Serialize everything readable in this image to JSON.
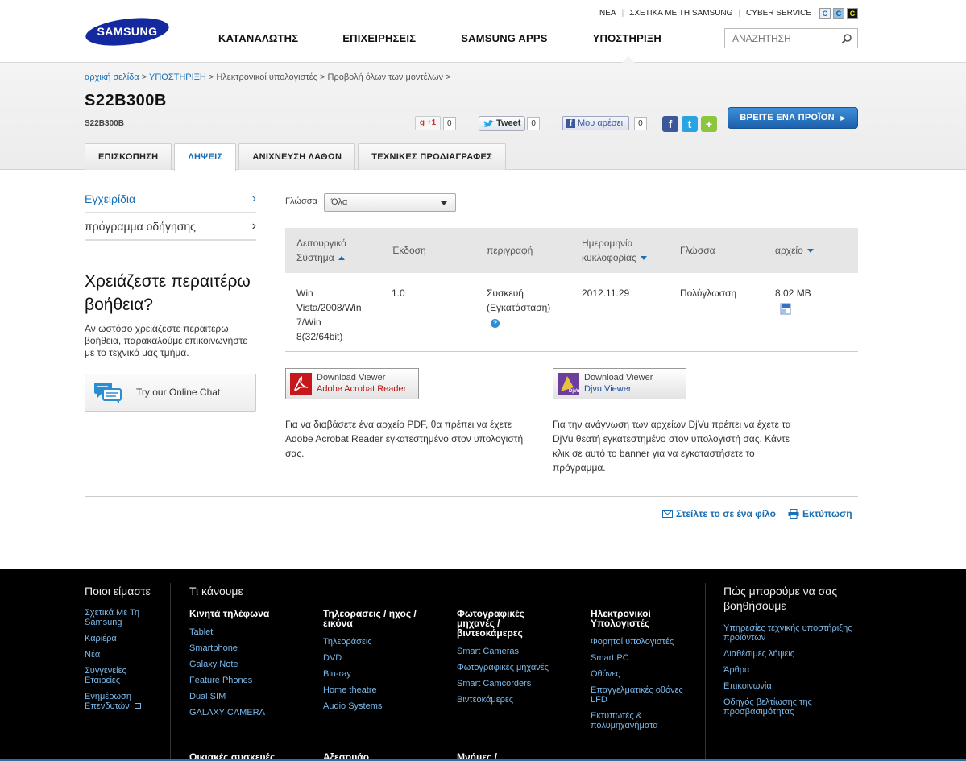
{
  "header": {
    "logo_text": "SAMSUNG",
    "util_links": [
      "ΝΕΑ",
      "ΣΧΕΤΙΚΑ ΜΕ ΤΗ SAMSUNG",
      "CYBER SERVICE"
    ],
    "contrast_buttons": [
      "C",
      "C",
      "C"
    ],
    "nav": [
      "ΚΑΤΑΝΑΛΩΤΗΣ",
      "ΕΠΙΧΕΙΡΗΣΕΙΣ",
      "SAMSUNG APPS",
      "ΥΠΟΣΤΗΡΙΞΗ"
    ],
    "search_placeholder": "ΑΝΑΖΗΤΗΣΗ"
  },
  "product": {
    "breadcrumb": [
      "αρχική σελίδα",
      "ΥΠΟΣΤΗΡΙΞΗ",
      "Ηλεκτρονικοί υπολογιστές",
      "Προβολή όλων των μοντέλων"
    ],
    "breadcrumb_sep": ">",
    "title": "S22B300B",
    "subtitle": "S22B300B",
    "social": {
      "gplus_label": "+1",
      "gplus_count": "0",
      "tweet_label": "Tweet",
      "tweet_count": "0",
      "like_label": "Μου αρέσει!",
      "like_count": "0"
    },
    "find_button": "ΒΡΕΙΤΕ ΕΝΑ ΠΡΟΪΟΝ",
    "tabs": [
      "ΕΠΙΣΚΟΠΗΣΗ",
      "ΛΗΨΕΙΣ",
      "ΑΝΙΧΝΕΥΣΗ ΛΑΘΩΝ",
      "ΤΕΧΝΙΚΕΣ ΠΡΟΔΙΑΓΡΑΦΕΣ"
    ],
    "active_tab": "ΛΗΨΕΙΣ"
  },
  "sidebar": {
    "items": [
      "Εγχειρίδια",
      "πρόγραμμα οδήγησης"
    ],
    "help_title": "Χρειάζεστε περαιτέρω βοήθεια?",
    "help_text": "Αν ωστόσο χρειάζεστε περαιτερω βοήθεια, παρακαλούμε επικοινωνήστε με το τεχνικό μας τμήμα.",
    "chat_label": "Try our Online Chat"
  },
  "downloads": {
    "language_label": "Γλώσσα",
    "language_value": "Όλα",
    "columns": {
      "os_line1": "Λειτουργικό",
      "os_line2": "Σύστημα",
      "version": "Έκδοση",
      "description": "περιγραφή",
      "date_line1": "Ημερομηνία",
      "date_line2": "κυκλοφορίας",
      "language": "Γλώσσα",
      "file": "αρχείο"
    },
    "rows": [
      {
        "os_lines": [
          "Win",
          "Vista/2008/Win",
          "7/Win",
          "8(32/64bit)"
        ],
        "version": "1.0",
        "description_line1": "Συσκευή",
        "description_line2": "(Εγκατάσταση)",
        "date": "2012.11.29",
        "language": "Πολύγλωσση",
        "size": "8.02 MB"
      }
    ],
    "viewers": [
      {
        "line1": "Download Viewer",
        "line2": "Adobe Acrobat Reader",
        "text_lines": [
          "Για να διαβάσετε ένα αρχείο PDF, θα πρέπει να έχετε",
          "Adobe Acrobat Reader εγκατεστημένο στον υπολογιστή",
          "σας."
        ]
      },
      {
        "line1": "Download Viewer",
        "line2": "Djvu Viewer",
        "text_lines": [
          "Για την ανάγνωση των αρχείων DjVu πρέπει να έχετε τα",
          "DjVu θεατή εγκατεστημένο στον υπολογιστή σας. Κάντε",
          "κλικ σε αυτό το banner για να εγκαταστήσετε το",
          "πρόγραμμα."
        ]
      }
    ],
    "send_friend": "Στείλτε το σε ένα φίλο",
    "print": "Εκτύπωση"
  },
  "footer": {
    "who_title": "Ποιοι είμαστε",
    "who_links": [
      "Σχετικά Με Τη Samsung",
      "Καριέρα",
      "Νέα",
      "Συγγενείες Εταιρείες",
      "Ενημέρωση Επενδυτών"
    ],
    "what_title": "Τι κάνουμε",
    "groups": [
      {
        "title": "Κινητά τηλέφωνα",
        "links": [
          "Tablet",
          "Smartphone",
          "Galaxy Note",
          "Feature Phones",
          "Dual SIM",
          "GALAXY CAMERA"
        ]
      },
      {
        "title": "Τηλεοράσεις / ήχος / εικόνα",
        "links": [
          "Τηλεοράσεις",
          "DVD",
          "Blu-ray",
          "Home theatre",
          "Audio Systems"
        ]
      },
      {
        "title": "Φωτογραφικές μηχανές / βιντεοκάμερες",
        "links": [
          "Smart Cameras",
          "Φωτογραφικές μηχανές",
          "Smart Camcorders",
          "Βιντεοκάμερες"
        ]
      },
      {
        "title": "Ηλεκτρονικοί Υπολογιστές",
        "links": [
          "Φορητοί υπολογιστές",
          "Smart PC",
          "Οθόνες",
          "Επαγγελματικές οθόνες LFD",
          "Εκτυπωτές & πολυμηχανήματα"
        ]
      }
    ],
    "bottom_groups": [
      "Οικιακές συσκευές",
      "Αξεσουάρ",
      "Μνήμες /"
    ],
    "help_title": "Πώς μπορούμε να σας βοηθήσουμε",
    "help_links": [
      "Υπηρεσίες τεχνικής υποστήριξης προϊόντων",
      "Διαθέσιμες λήψεις",
      "Άρθρα",
      "Επικοινωνία",
      "Οδηγός βελτίωσης της προσβασιμότητας"
    ]
  }
}
